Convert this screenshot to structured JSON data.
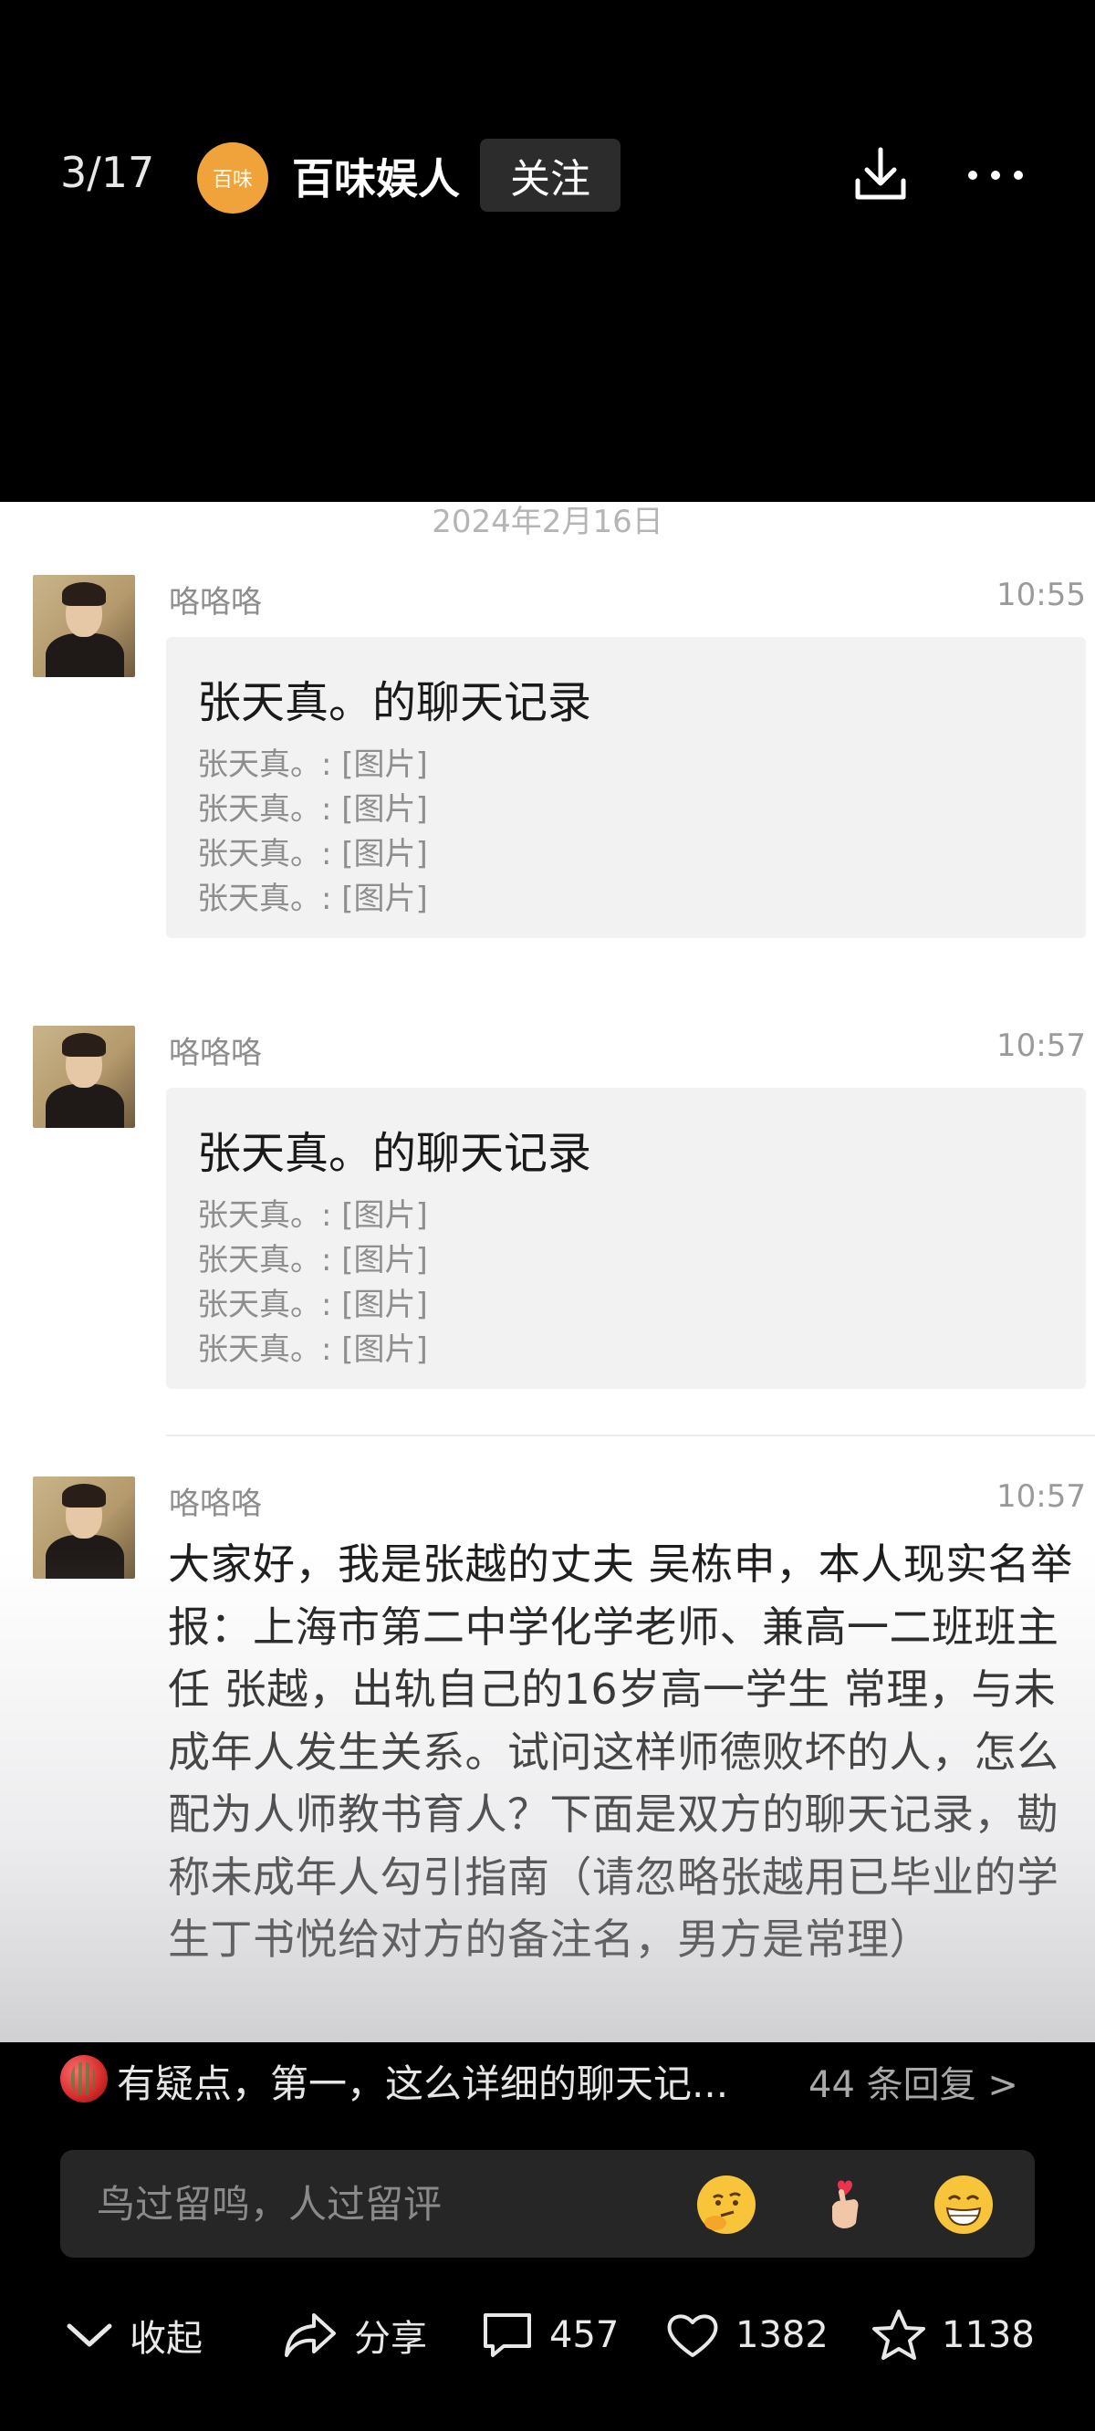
{
  "topbar": {
    "page_counter": "3/17",
    "logo_text": "百味",
    "account_name": "百味娱人",
    "follow_label": "关注",
    "download_icon": "download-icon",
    "more_icon": "more-icon"
  },
  "screenshot": {
    "date_header": "2024年2月16日",
    "messages": [
      {
        "sender": "咯咯咯",
        "time": "10:55",
        "card_title": "张天真。的聊天记录",
        "lines": [
          "张天真。: [图片]",
          "张天真。: [图片]",
          "张天真。: [图片]",
          "张天真。: [图片]"
        ]
      },
      {
        "sender": "咯咯咯",
        "time": "10:57",
        "card_title": "张天真。的聊天记录",
        "lines": [
          "张天真。: [图片]",
          "张天真。: [图片]",
          "张天真。: [图片]",
          "张天真。: [图片]"
        ]
      },
      {
        "sender": "咯咯咯",
        "time": "10:57",
        "text": "大家好，我是张越的丈夫 吴栋申，本人现实名举报：上海市第二中学化学老师、兼高一二班班主任 张越，出轨自己的16岁高一学生 常理，与未成年人发生关系。试问这样师德败坏的人，怎么配为人师教书育人？下面是双方的聊天记录，勘称未成年人勾引指南（请忽略张越用已毕业的学生丁书悦给对方的备注名，男方是常理）"
      }
    ]
  },
  "comment": {
    "text": "有疑点，第一，这么详细的聊天记...",
    "reply_count": "44 条回复 >"
  },
  "input": {
    "placeholder": "鸟过留鸣，人过留评"
  },
  "actions": {
    "collapse": "收起",
    "share": "分享",
    "comments": "457",
    "likes": "1382",
    "favorites": "1138"
  }
}
